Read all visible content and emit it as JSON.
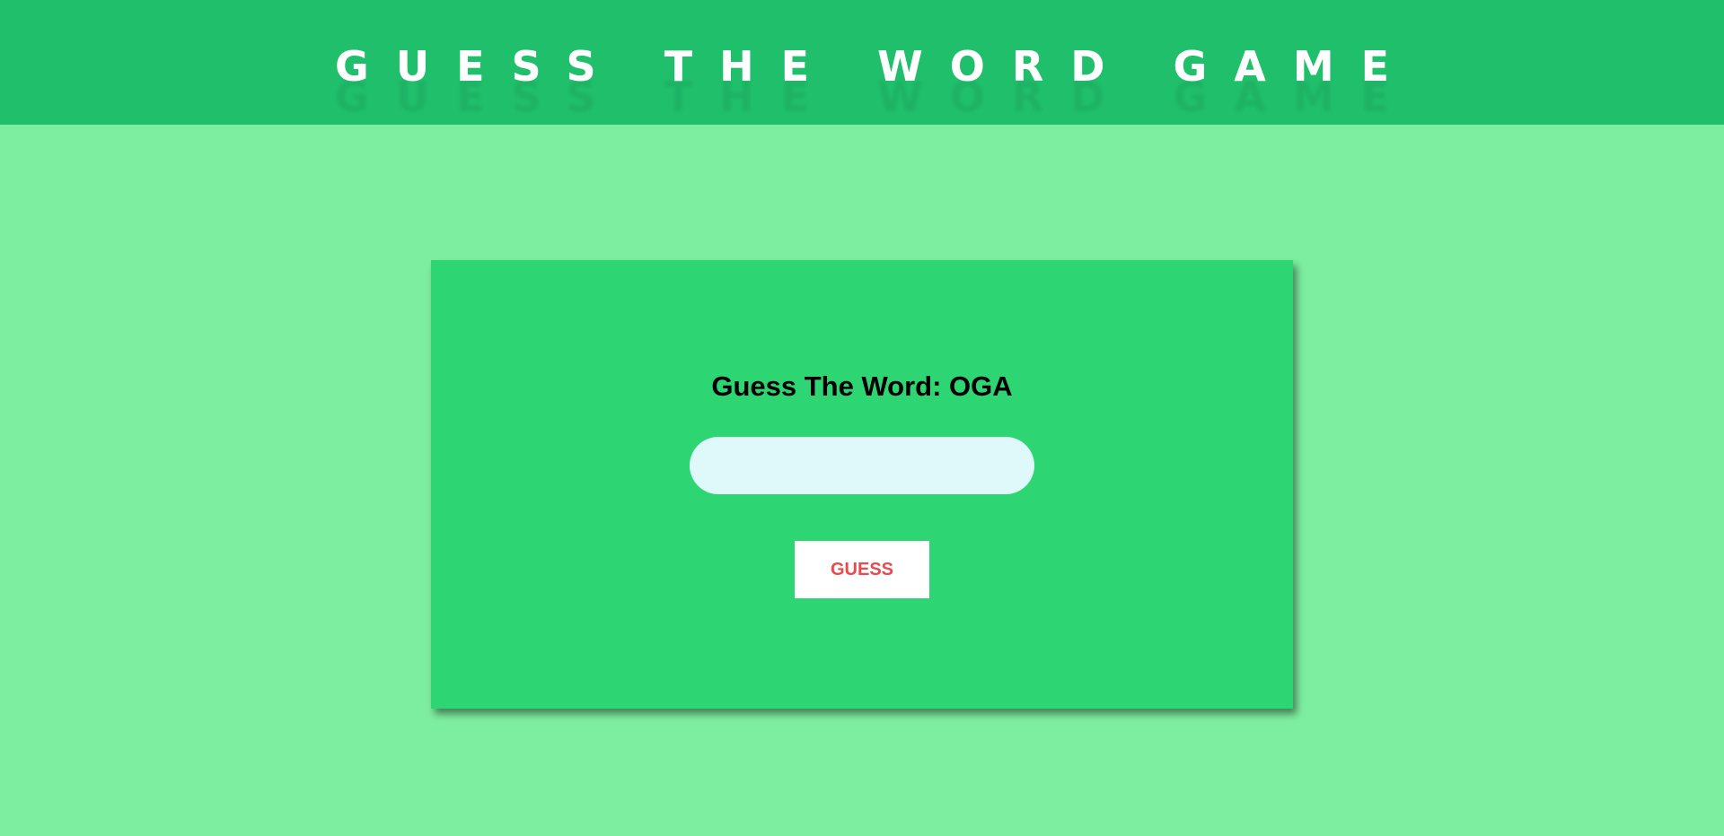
{
  "header": {
    "title": "GUESS THE WORD GAME"
  },
  "game": {
    "prompt": "Guess The Word: OGA",
    "input": {
      "value": "",
      "placeholder": ""
    },
    "button_label": "GUESS"
  },
  "colors": {
    "page_background": "#7deea0",
    "header_background": "#20bf6b",
    "card_background": "#2ed573",
    "input_background": "#dff9fb",
    "button_text": "#e84a4e"
  }
}
